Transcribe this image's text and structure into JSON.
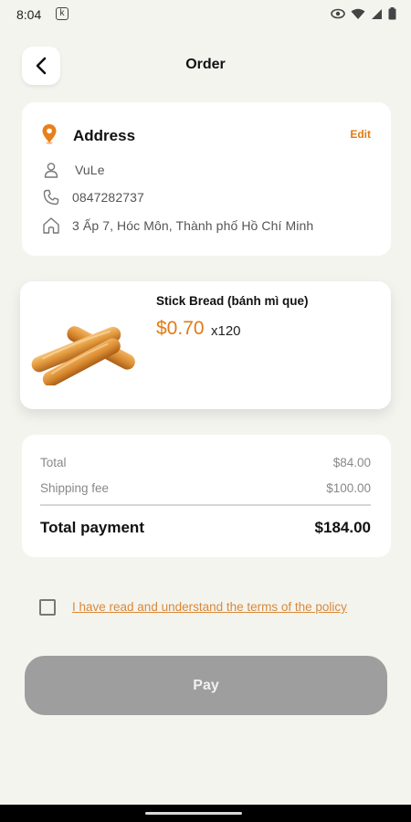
{
  "status": {
    "time": "8:04",
    "notification_badge": "k"
  },
  "header": {
    "title": "Order"
  },
  "address": {
    "heading": "Address",
    "edit_label": "Edit",
    "name": "VuLe",
    "phone": "0847282737",
    "street": "3 Ấp 7, Hóc Môn, Thành phố Hồ Chí Minh"
  },
  "product": {
    "name": "Stick Bread (bánh mì que)",
    "price": "$0.70",
    "quantity": "x120"
  },
  "summary": {
    "rows": [
      {
        "label": "Total",
        "value": "$84.00"
      },
      {
        "label": "Shipping fee",
        "value": "$100.00"
      }
    ],
    "total_label": "Total payment",
    "total_value": "$184.00"
  },
  "terms": {
    "checked": false,
    "text": "I have read and understand the terms of the policy"
  },
  "pay_button": {
    "label": "Pay",
    "enabled": false
  },
  "colors": {
    "accent": "#e07b15",
    "background": "#f4f4ef",
    "disabled_button": "#9e9e9e"
  }
}
